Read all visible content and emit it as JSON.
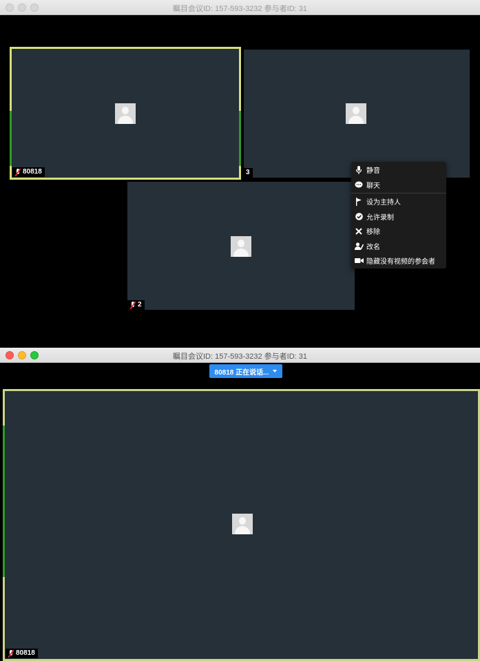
{
  "top_window": {
    "title": "瞩目会议ID: 157-593-3232 参与者ID: 31",
    "tiles": [
      {
        "name": "80818",
        "muted": true,
        "active_speaker": true
      },
      {
        "name": "3",
        "muted": false,
        "active_speaker": false
      },
      {
        "name": "2",
        "muted": true,
        "active_speaker": false
      }
    ],
    "context_menu": {
      "items": [
        "静音",
        "聊天",
        "设为主持人",
        "允许录制",
        "移除",
        "改名",
        "隐藏没有视频的参会者"
      ],
      "icons": [
        "microphone-icon",
        "chat-bubble-icon",
        "flag-icon",
        "check-circle-icon",
        "close-icon",
        "rename-user-icon",
        "video-camera-icon"
      ]
    }
  },
  "bottom_window": {
    "title": "瞩目会议ID: 157-593-3232 参与者ID: 31",
    "speaker_button_label": "80818 正在说话...",
    "main_tile": {
      "name": "80818",
      "muted": true
    }
  },
  "colors": {
    "tile_background": "#263039",
    "active_speaker_border": "#d6e07a",
    "speaker_button": "#2e8cf0",
    "menu_background": "#1c1c1c"
  }
}
